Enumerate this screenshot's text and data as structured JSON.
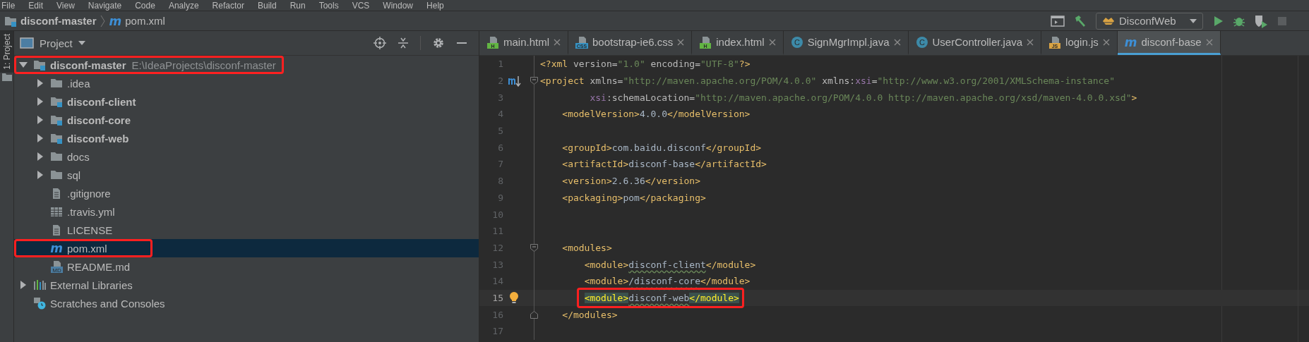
{
  "menu_bar": {
    "items": [
      "File",
      "Edit",
      "View",
      "Navigate",
      "Code",
      "Analyze",
      "Refactor",
      "Build",
      "Run",
      "Tools",
      "VCS",
      "Window",
      "Help"
    ]
  },
  "breadcrumbs": [
    {
      "label": "disconf-master",
      "kind": "module"
    },
    {
      "label": "pom.xml",
      "kind": "maven",
      "icon_text": "m"
    }
  ],
  "toolbar": {
    "run_config": "DisconfWeb"
  },
  "side_strip": {
    "label": "1: Project",
    "selected": true
  },
  "project_panel": {
    "title": "Project",
    "tree": [
      {
        "label": "disconf-master",
        "path": "E:\\IdeaProjects\\disconf-master",
        "kind": "module",
        "expanded": true,
        "selected": false,
        "annotated": true,
        "children": [
          {
            "label": ".idea",
            "kind": "folder",
            "expanded": false,
            "selected": false,
            "annotated": false
          },
          {
            "label": "disconf-client",
            "kind": "module",
            "expanded": false,
            "selected": false,
            "annotated": false
          },
          {
            "label": "disconf-core",
            "kind": "module",
            "expanded": false,
            "selected": false,
            "annotated": false
          },
          {
            "label": "disconf-web",
            "kind": "module",
            "expanded": false,
            "selected": false,
            "annotated": false
          },
          {
            "label": "docs",
            "kind": "folder",
            "expanded": false,
            "selected": false,
            "annotated": false
          },
          {
            "label": "sql",
            "kind": "folder",
            "expanded": false,
            "selected": false,
            "annotated": false
          },
          {
            "label": ".gitignore",
            "kind": "file",
            "selected": false,
            "annotated": false
          },
          {
            "label": ".travis.yml",
            "kind": "table",
            "selected": false,
            "annotated": false
          },
          {
            "label": "LICENSE",
            "kind": "file",
            "selected": false,
            "annotated": false
          },
          {
            "label": "pom.xml",
            "kind": "maven",
            "icon_text": "m",
            "selected": true,
            "annotated": true
          },
          {
            "label": "README.md",
            "kind": "markdown",
            "icon_text": "MD",
            "selected": false,
            "annotated": false
          }
        ]
      },
      {
        "label": "External Libraries",
        "kind": "libraries",
        "expanded": false,
        "selected": false,
        "annotated": false
      },
      {
        "label": "Scratches and Consoles",
        "kind": "scratches",
        "selected": false,
        "annotated": false
      }
    ]
  },
  "editor": {
    "tabs": [
      {
        "label": "main.html",
        "kind": "html",
        "icon_text": "H",
        "selected": false
      },
      {
        "label": "bootstrap-ie6.css",
        "kind": "css",
        "icon_text": "CSS",
        "selected": false
      },
      {
        "label": "index.html",
        "kind": "html",
        "icon_text": "H",
        "selected": false
      },
      {
        "label": "SignMgrImpl.java",
        "kind": "java",
        "icon_text": "C",
        "selected": false
      },
      {
        "label": "UserController.java",
        "kind": "java",
        "icon_text": "C",
        "selected": false
      },
      {
        "label": "login.js",
        "kind": "js",
        "icon_text": "JS",
        "selected": false
      },
      {
        "label": "disconf-base",
        "kind": "maven",
        "icon_text": "m",
        "selected": true
      }
    ],
    "lines": [
      {
        "number": "1",
        "current": false,
        "annotated": false,
        "tokens": [
          {
            "kind": "tag",
            "text": "<?xml"
          },
          {
            "kind": "attr",
            "text": " version="
          },
          {
            "kind": "str",
            "text": "\"1.0\""
          },
          {
            "kind": "attr",
            "text": " encoding="
          },
          {
            "kind": "str",
            "text": "\"UTF-8\""
          },
          {
            "kind": "tag",
            "text": "?>"
          }
        ]
      },
      {
        "number": "2",
        "current": false,
        "annotated": false,
        "gutter_icon": {
          "kind": "maven"
        },
        "fold": {
          "kind": "start"
        },
        "tokens": [
          {
            "kind": "tag",
            "text": "<project"
          },
          {
            "kind": "attr",
            "text": " xmlns="
          },
          {
            "kind": "str",
            "text": "\"http://maven.apache.org/POM/4.0.0\""
          },
          {
            "kind": "attr",
            "text": " xmlns:"
          },
          {
            "kind": "ns",
            "text": "xsi"
          },
          {
            "kind": "attr",
            "text": "="
          },
          {
            "kind": "str",
            "text": "\"http://www.w3.org/2001/XMLSchema-instance\""
          }
        ]
      },
      {
        "number": "3",
        "current": false,
        "annotated": false,
        "tokens": [
          {
            "kind": "ns",
            "text": "         xsi"
          },
          {
            "kind": "attr",
            "text": ":schemaLocation="
          },
          {
            "kind": "str",
            "text": "\"http://maven.apache.org/POM/4.0.0 http://maven.apache.org/xsd/maven-4.0.0.xsd\""
          },
          {
            "kind": "tag",
            "text": ">"
          }
        ]
      },
      {
        "number": "4",
        "current": false,
        "annotated": false,
        "tokens": [
          {
            "kind": "tag",
            "text": "    <modelVersion>"
          },
          {
            "kind": "text",
            "text": "4.0.0"
          },
          {
            "kind": "tag",
            "text": "</modelVersion>"
          }
        ]
      },
      {
        "number": "5",
        "current": false,
        "annotated": false
      },
      {
        "number": "6",
        "current": false,
        "annotated": false,
        "tokens": [
          {
            "kind": "tag",
            "text": "    <groupId>"
          },
          {
            "kind": "text",
            "text": "com.baidu.disconf"
          },
          {
            "kind": "tag",
            "text": "</groupId>"
          }
        ]
      },
      {
        "number": "7",
        "current": false,
        "annotated": false,
        "tokens": [
          {
            "kind": "tag",
            "text": "    <artifactId>"
          },
          {
            "kind": "text",
            "text": "disconf-base"
          },
          {
            "kind": "tag",
            "text": "</artifactId>"
          }
        ]
      },
      {
        "number": "8",
        "current": false,
        "annotated": false,
        "tokens": [
          {
            "kind": "tag",
            "text": "    <version>"
          },
          {
            "kind": "text",
            "text": "2.6.36"
          },
          {
            "kind": "tag",
            "text": "</version>"
          }
        ]
      },
      {
        "number": "9",
        "current": false,
        "annotated": false,
        "tokens": [
          {
            "kind": "tag",
            "text": "    <packaging>"
          },
          {
            "kind": "text",
            "text": "pom"
          },
          {
            "kind": "tag",
            "text": "</packaging>"
          }
        ]
      },
      {
        "number": "10",
        "current": false,
        "annotated": false
      },
      {
        "number": "11",
        "current": false,
        "annotated": false
      },
      {
        "number": "12",
        "current": false,
        "annotated": false,
        "fold": {
          "kind": "start"
        },
        "tokens": [
          {
            "kind": "tag",
            "text": "    <modules>"
          }
        ]
      },
      {
        "number": "13",
        "current": false,
        "annotated": false,
        "tokens": [
          {
            "kind": "tag",
            "text": "        <module>"
          },
          {
            "kind": "text_warn",
            "text": "disconf-client"
          },
          {
            "kind": "tag",
            "text": "</module>"
          }
        ]
      },
      {
        "number": "14",
        "current": false,
        "annotated": false,
        "tokens": [
          {
            "kind": "tag",
            "text": "        <module>"
          },
          {
            "kind": "text_warn",
            "text": "/disconf-core"
          },
          {
            "kind": "tag",
            "text": "</module>"
          }
        ]
      },
      {
        "number": "15",
        "current": true,
        "annotated": true,
        "gutter_icon": {
          "kind": "bulb"
        },
        "tokens": [
          {
            "kind": "tag_match",
            "text": "        <module>"
          },
          {
            "kind": "text_warn",
            "text": "disconf-web"
          },
          {
            "kind": "tag_match",
            "text": "</module>"
          }
        ]
      },
      {
        "number": "16",
        "current": false,
        "annotated": false,
        "fold": {
          "kind": "end"
        },
        "tokens": [
          {
            "kind": "tag",
            "text": "    </modules>"
          }
        ]
      },
      {
        "number": "17",
        "current": false,
        "annotated": false
      }
    ]
  }
}
